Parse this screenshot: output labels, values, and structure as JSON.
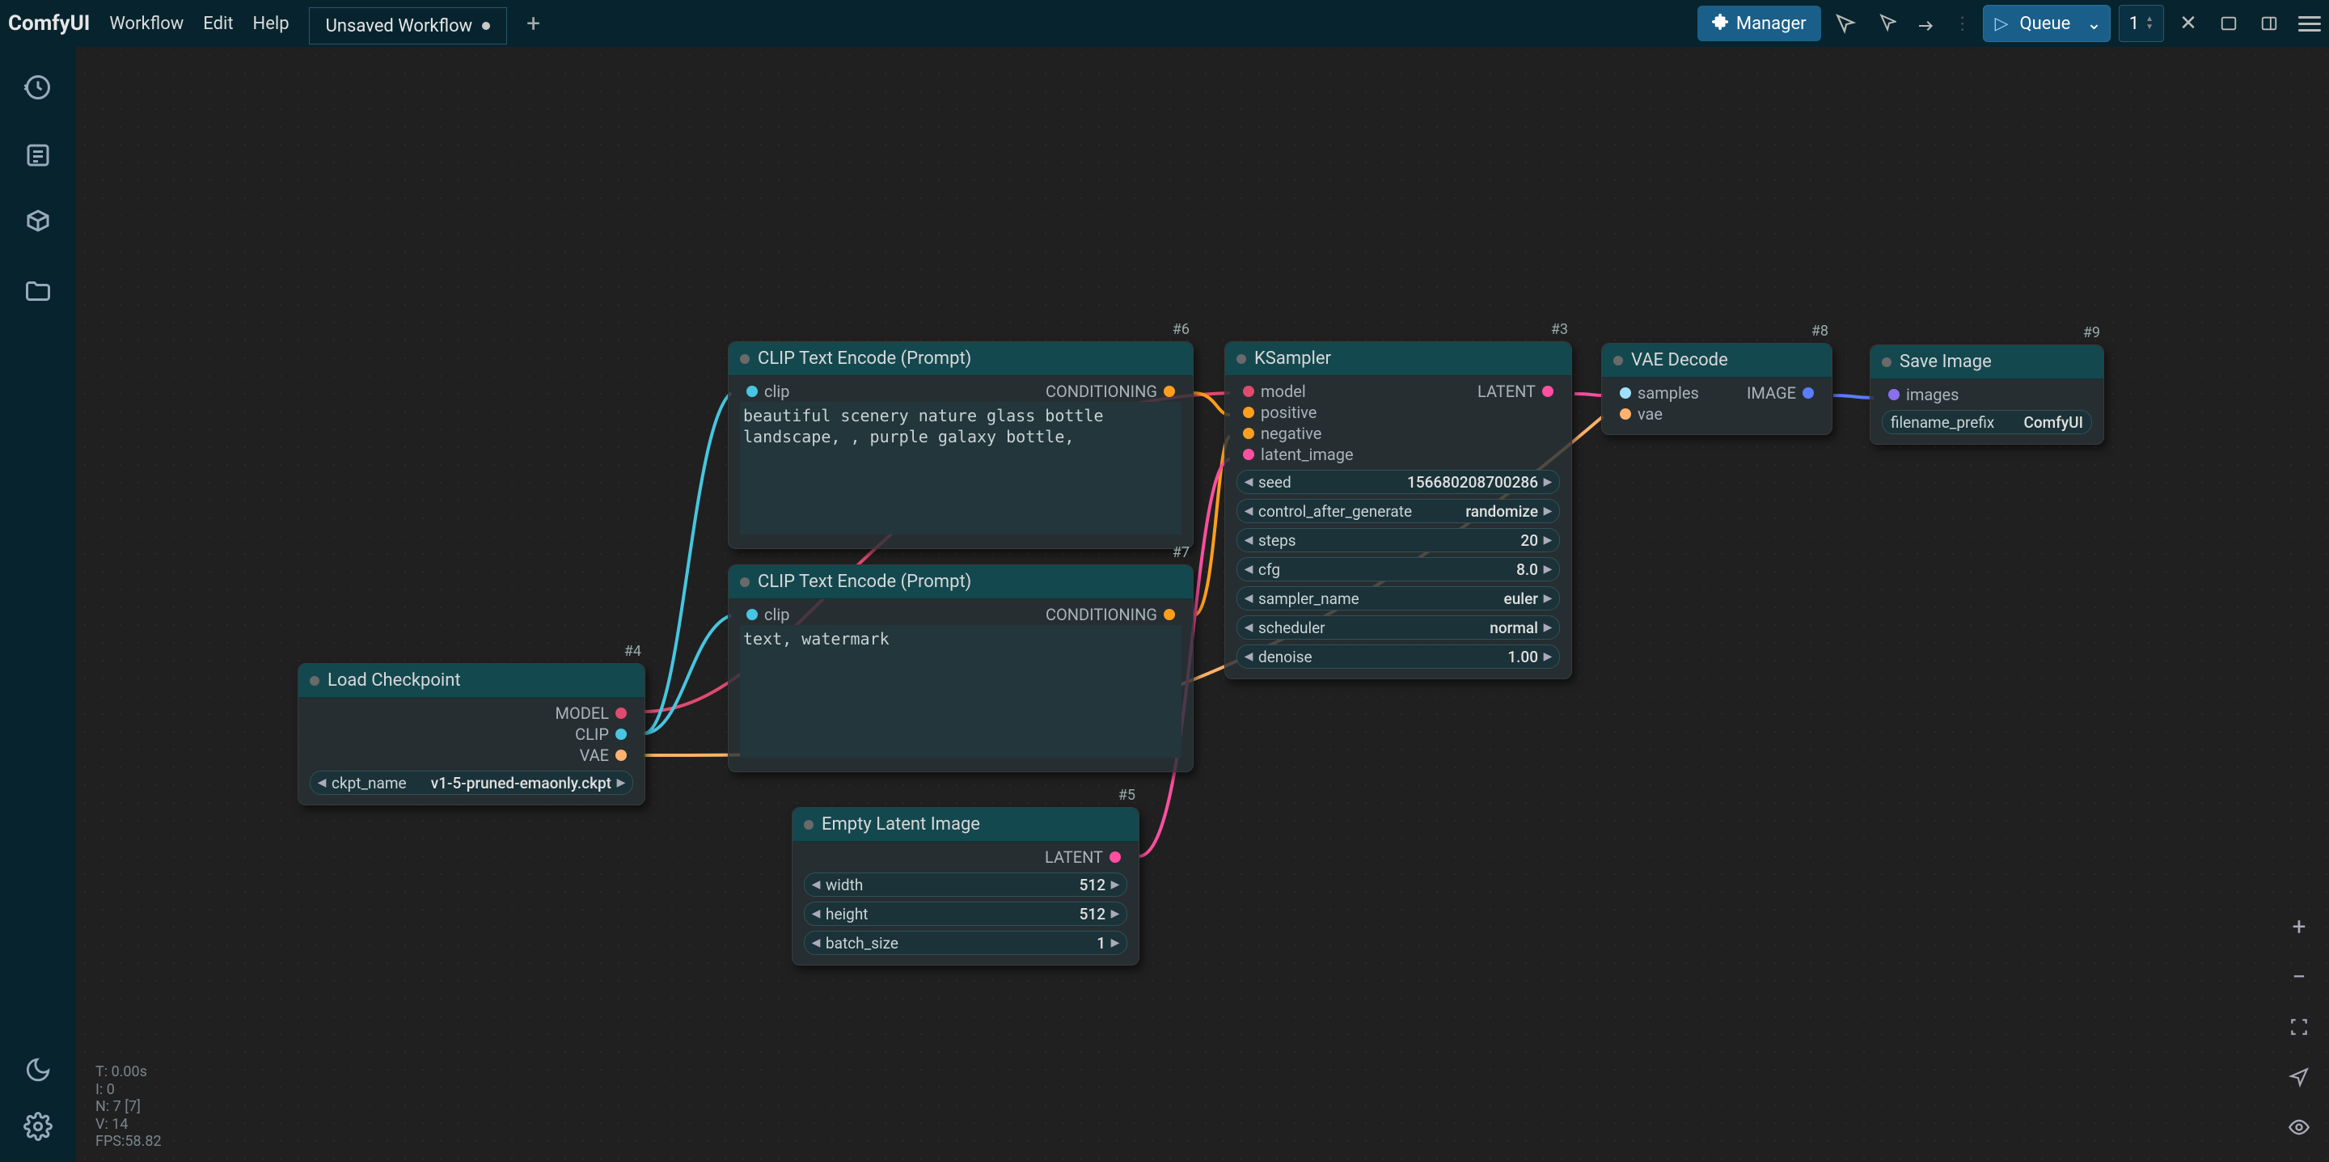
{
  "app": {
    "name": "ComfyUI"
  },
  "menu": {
    "workflow": "Workflow",
    "edit": "Edit",
    "help": "Help"
  },
  "tab": {
    "title": "Unsaved Workflow"
  },
  "toolbar": {
    "manager": "Manager",
    "queue": "Queue",
    "batchCount": "1"
  },
  "nodes": {
    "loadCkpt": {
      "id": "#4",
      "title": "Load Checkpoint",
      "out_model": "MODEL",
      "out_clip": "CLIP",
      "out_vae": "VAE",
      "ckptName_label": "ckpt_name",
      "ckptName_value": "v1-5-pruned-emaonly.ckpt"
    },
    "clip6": {
      "id": "#6",
      "title": "CLIP Text Encode (Prompt)",
      "in_clip": "clip",
      "out_cond": "CONDITIONING",
      "text": "beautiful scenery nature glass bottle landscape, , purple galaxy bottle,"
    },
    "clip7": {
      "id": "#7",
      "title": "CLIP Text Encode (Prompt)",
      "in_clip": "clip",
      "out_cond": "CONDITIONING",
      "text": "text, watermark"
    },
    "emptyLatent": {
      "id": "#5",
      "title": "Empty Latent Image",
      "out_latent": "LATENT",
      "width_label": "width",
      "width_value": "512",
      "height_label": "height",
      "height_value": "512",
      "batch_label": "batch_size",
      "batch_value": "1"
    },
    "ksampler": {
      "id": "#3",
      "title": "KSampler",
      "in_model": "model",
      "in_positive": "positive",
      "in_negative": "negative",
      "in_latent": "latent_image",
      "out_latent": "LATENT",
      "seed_label": "seed",
      "seed_value": "156680208700286",
      "cag_label": "control_after_generate",
      "cag_value": "randomize",
      "steps_label": "steps",
      "steps_value": "20",
      "cfg_label": "cfg",
      "cfg_value": "8.0",
      "sampler_label": "sampler_name",
      "sampler_value": "euler",
      "scheduler_label": "scheduler",
      "scheduler_value": "normal",
      "denoise_label": "denoise",
      "denoise_value": "1.00"
    },
    "vaeDecode": {
      "id": "#8",
      "title": "VAE Decode",
      "in_samples": "samples",
      "in_vae": "vae",
      "out_image": "IMAGE"
    },
    "saveImage": {
      "id": "#9",
      "title": "Save Image",
      "in_images": "images",
      "prefix_label": "filename_prefix",
      "prefix_value": "ComfyUI"
    }
  },
  "stats": {
    "t": "T: 0.00s",
    "i": "I: 0",
    "n": "N: 7 [7]",
    "v": "V: 14",
    "fps": "FPS:58.82"
  }
}
